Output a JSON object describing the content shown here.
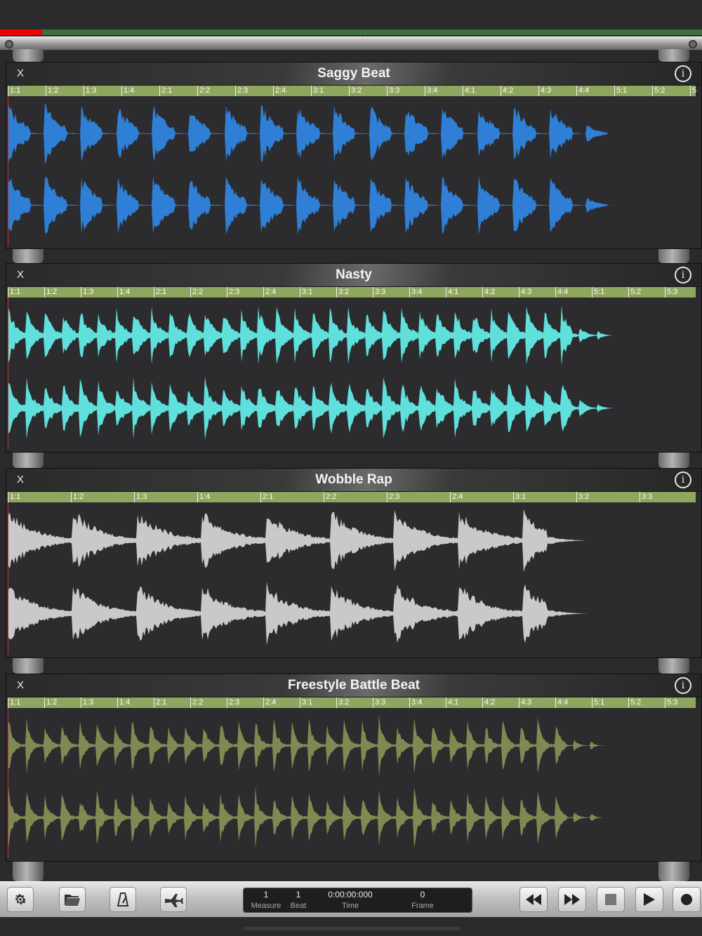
{
  "tracks": [
    {
      "title": "Saggy Beat",
      "close_label": "X",
      "info_label": "i",
      "color": "#2f7fd6",
      "ticks": [
        "1:1",
        "1:2",
        "1:3",
        "1:4",
        "2:1",
        "2:2",
        "2:3",
        "2:4",
        "3:1",
        "3:2",
        "3:3",
        "3:4",
        "4:1",
        "4:2",
        "4:3",
        "4:4",
        "5:1",
        "5:2",
        "5"
      ],
      "wave_extent": 0.89
    },
    {
      "title": "Nasty",
      "close_label": "X",
      "info_label": "i",
      "color": "#5fe0dc",
      "ticks": [
        "1:1",
        "1:2",
        "1:3",
        "1:4",
        "2:1",
        "2:2",
        "2:3",
        "2:4",
        "3:1",
        "3:2",
        "3:3",
        "3:4",
        "4:1",
        "4:2",
        "4:3",
        "4:4",
        "5:1",
        "5:2",
        "5:3"
      ],
      "wave_extent": 0.88
    },
    {
      "title": "Wobble Rap",
      "close_label": "X",
      "info_label": "i",
      "color": "#c9c9c9",
      "ticks": [
        "1:1",
        "1:2",
        "1:3",
        "1:4",
        "2:1",
        "2:2",
        "2:3",
        "2:4",
        "3:1",
        "3:2",
        "3:3"
      ],
      "wave_extent": 0.84
    },
    {
      "title": "Freestyle Battle Beat",
      "close_label": "X",
      "info_label": "i",
      "color": "#7f8a52",
      "ticks": [
        "1:1",
        "1:2",
        "1:3",
        "1:4",
        "2:1",
        "2:2",
        "2:3",
        "2:4",
        "3:1",
        "3:2",
        "3:3",
        "3:4",
        "4:1",
        "4:2",
        "4:3",
        "4:4",
        "5:1",
        "5:2",
        "5:3"
      ],
      "wave_extent": 0.87
    }
  ],
  "transport": {
    "measure_value": "1",
    "measure_label": "Measure",
    "beat_value": "1",
    "beat_label": "Beat",
    "time_value": "0:00:00:000",
    "time_label": "Time",
    "frame_value": "0",
    "frame_label": "Frame"
  },
  "toolbar_icons": [
    "gear-icon",
    "folder-icon",
    "metronome-icon",
    "airplane-icon",
    "rewind-icon",
    "fast-forward-icon",
    "stop-icon",
    "play-icon",
    "record-icon"
  ]
}
